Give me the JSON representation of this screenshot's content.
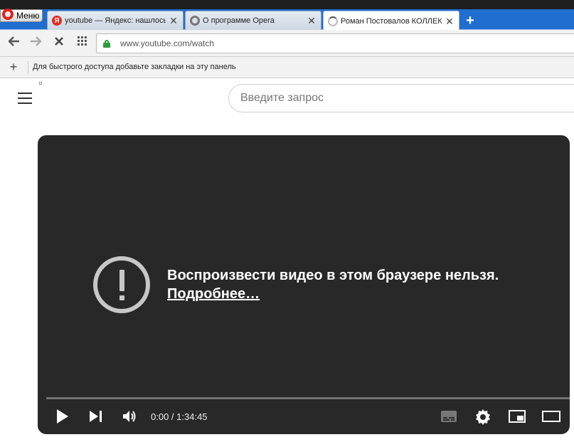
{
  "browser": {
    "menu_label": "Меню",
    "tabs": [
      {
        "icon": "yandex-icon",
        "title": "youtube — Яндекс: нашлось",
        "close": "✕",
        "active": false
      },
      {
        "icon": "opera-icon",
        "title": "О программе Opera",
        "close": "✕",
        "active": false
      },
      {
        "icon": "loading-spinner-icon",
        "title": "Роман Постовалов КОЛЛЕКЦИЯ",
        "close": "✕",
        "active": true
      }
    ],
    "new_tab": "+",
    "nav": {
      "back": "🡐",
      "forward": "🡒",
      "stop": "✕",
      "speed_dial": "grid-icon"
    },
    "url": "www.youtube.com/watch",
    "bookmarks_add": "+",
    "bookmarks_hint": "Для быстрого доступа добавьте закладки на эту панель",
    "accent": "#1f6ed0"
  },
  "youtube": {
    "search_placeholder": "Введите запрос",
    "player": {
      "error_message": "Воспроизвести видео в этом браузере нельзя.",
      "error_link": "Подробнее…",
      "time_current": "0:00",
      "time_separator": " / ",
      "time_total": "1:34:45",
      "progress": 0.0
    }
  }
}
